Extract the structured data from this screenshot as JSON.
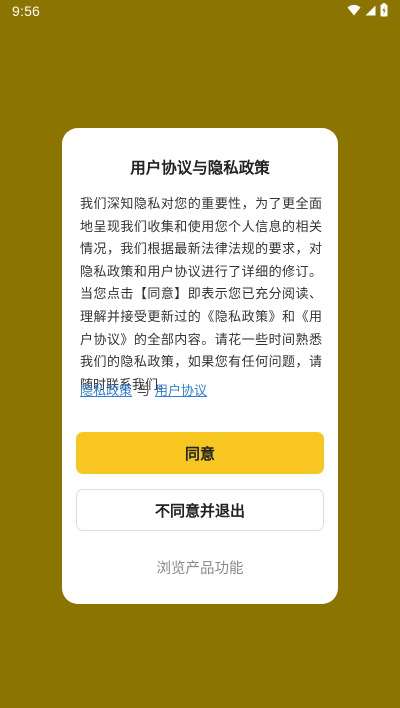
{
  "status_bar": {
    "time": "9:56",
    "icons": [
      "wifi-icon",
      "signal-icon",
      "battery-icon"
    ]
  },
  "dialog": {
    "title": "用户协议与隐私政策",
    "body": "我们深知隐私对您的重要性，为了更全面地呈现我们收集和使用您个人信息的相关情况，我们根据最新法律法规的要求，对隐私政策和用户协议进行了详细的修订。当您点击【同意】即表示您已充分阅读、理解并接受更新过的《隐私政策》和《用户协议》的全部内容。请花一些时间熟悉我们的隐私政策，如果您有任何问题，请随时联系我们。",
    "links": {
      "privacy": "隐私政策",
      "separator": "与",
      "agreement": "用户协议"
    },
    "agree_label": "同意",
    "exit_label": "不同意并退出",
    "browse_label": "浏览产品功能"
  },
  "colors": {
    "background": "#8b7400",
    "accent": "#f8c620",
    "link": "#2f7fd8"
  }
}
